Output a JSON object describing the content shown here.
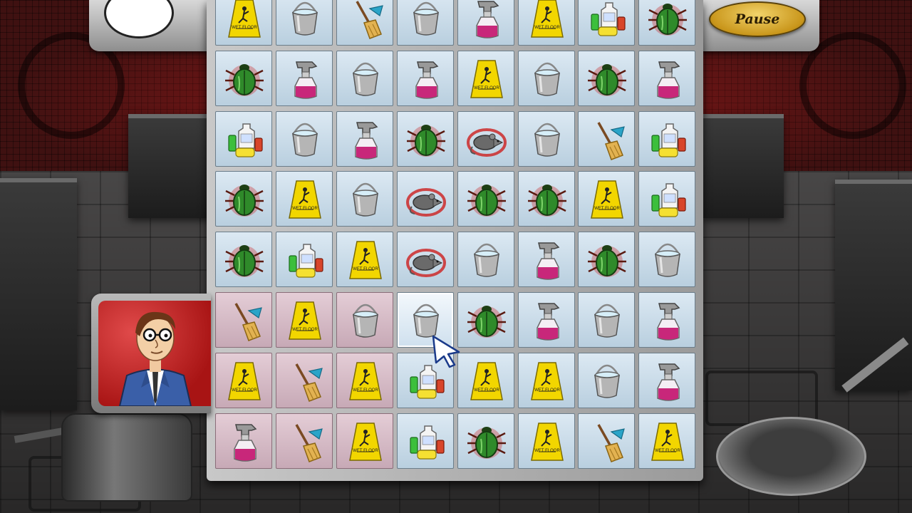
{
  "hud": {
    "pause_label": "Pause",
    "score_display": ""
  },
  "board": {
    "rows": 8,
    "cols": 8,
    "cells": [
      [
        "wet-floor-sign",
        "bucket",
        "broom",
        "bucket",
        "spray-bottle",
        "wet-floor-sign",
        "cleaning-supplies",
        "beetle"
      ],
      [
        "beetle",
        "spray-bottle",
        "bucket",
        "spray-bottle",
        "wet-floor-sign",
        "bucket",
        "beetle",
        "spray-bottle"
      ],
      [
        "cleaning-supplies",
        "bucket",
        "spray-bottle",
        "beetle",
        "rat",
        "bucket",
        "broom",
        "cleaning-supplies"
      ],
      [
        "beetle",
        "wet-floor-sign",
        "bucket",
        "rat",
        "beetle",
        "beetle",
        "wet-floor-sign",
        "cleaning-supplies"
      ],
      [
        "beetle",
        "cleaning-supplies",
        "wet-floor-sign",
        "rat",
        "bucket",
        "spray-bottle",
        "beetle",
        "bucket"
      ],
      [
        "broom",
        "wet-floor-sign",
        "bucket",
        "bucket",
        "beetle",
        "spray-bottle",
        "bucket",
        "spray-bottle"
      ],
      [
        "wet-floor-sign",
        "broom",
        "wet-floor-sign",
        "cleaning-supplies",
        "wet-floor-sign",
        "wet-floor-sign",
        "bucket",
        "spray-bottle"
      ],
      [
        "spray-bottle",
        "broom",
        "wet-floor-sign",
        "cleaning-supplies",
        "beetle",
        "wet-floor-sign",
        "broom",
        "wet-floor-sign"
      ]
    ],
    "cleaned": [
      [
        5,
        0
      ],
      [
        5,
        1
      ],
      [
        5,
        2
      ],
      [
        6,
        0
      ],
      [
        6,
        1
      ],
      [
        6,
        2
      ],
      [
        7,
        0
      ],
      [
        7,
        1
      ],
      [
        7,
        2
      ]
    ],
    "selected": [
      5,
      3
    ],
    "sign_text": "WET FLOOR"
  },
  "character": {
    "name": "manager-portrait"
  },
  "colors": {
    "tile": "#c9dbe8",
    "tile_cleaned": "#d6bcc6",
    "pause_gold": "#d9ae3a",
    "portrait_red": "#c42525",
    "beetle_green": "#2f8a2a",
    "sign_yellow": "#f2d600"
  }
}
